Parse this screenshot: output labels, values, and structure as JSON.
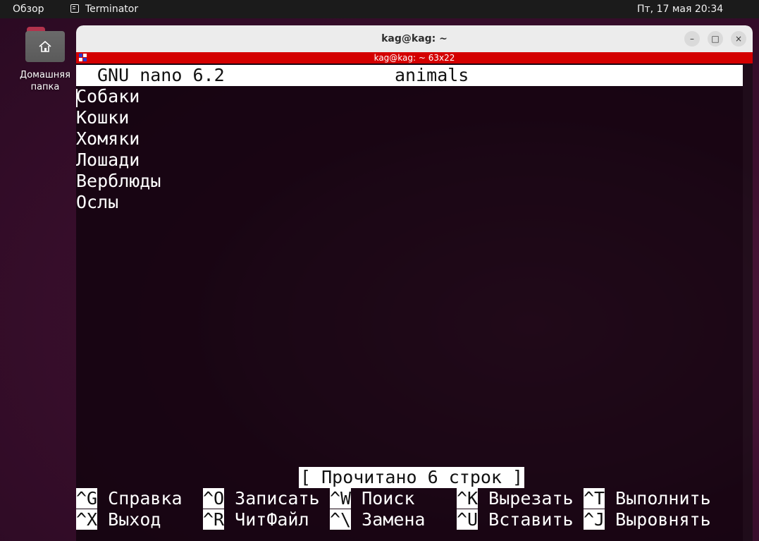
{
  "topbar": {
    "overview": "Обзор",
    "app_name": "Terminator",
    "clock": "Пт, 17 мая  20:34"
  },
  "desktop": {
    "home_label": "Домашняя папка"
  },
  "window": {
    "title": "kag@kag: ~",
    "terminal_header": "kag@kag: ~ 63x22",
    "buttons": {
      "minimize": "–",
      "maximize": "□",
      "close": "×"
    }
  },
  "nano": {
    "version": "GNU nano 6.2",
    "filename": "animals",
    "lines": [
      "Собаки",
      "Кошки",
      "Хомяки",
      "Лошади",
      "Верблюды",
      "Ослы"
    ],
    "status": "[ Прочитано 6 строк ]",
    "shortcuts_row1": [
      {
        "key": "^G",
        "label": "Справка"
      },
      {
        "key": "^O",
        "label": "Записать"
      },
      {
        "key": "^W",
        "label": "Поиск"
      },
      {
        "key": "^K",
        "label": "Вырезать"
      },
      {
        "key": "^T",
        "label": "Выполнить"
      }
    ],
    "shortcuts_row2": [
      {
        "key": "^X",
        "label": "Выход"
      },
      {
        "key": "^R",
        "label": "ЧитФайл"
      },
      {
        "key": "^\\",
        "label": "Замена"
      },
      {
        "key": "^U",
        "label": "Вставить"
      },
      {
        "key": "^J",
        "label": "Выровнять"
      }
    ]
  },
  "colors": {
    "terminal_header": "#d40000",
    "titlebar": "#ececec",
    "topbar": "#1b1b1b"
  }
}
